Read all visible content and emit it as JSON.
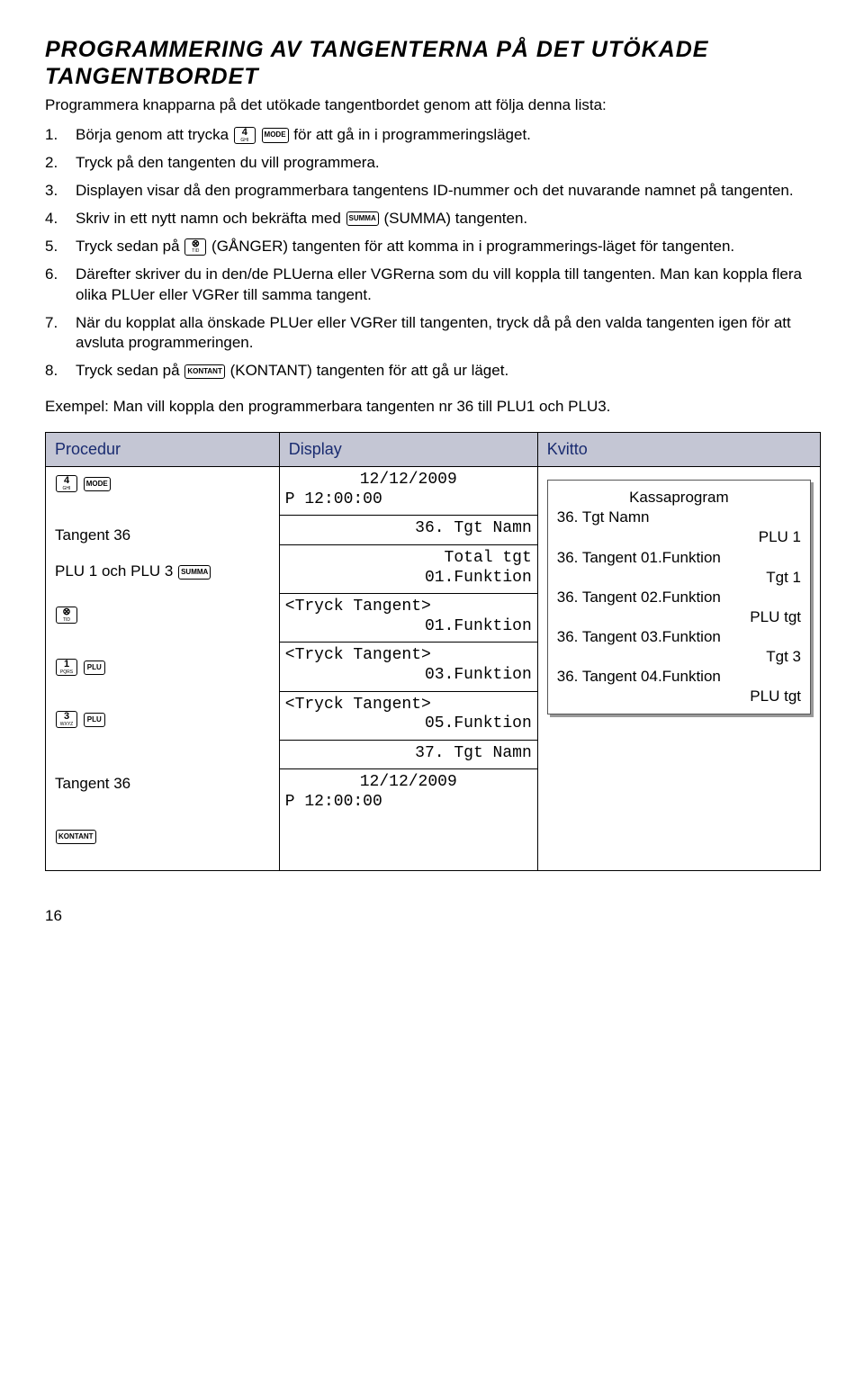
{
  "title": "PROGRAMMERING AV TANGENTERNA PÅ DET UTÖKADE TANGENTBORDET",
  "intro": "Programmera knapparna på det utökade tangentbordet genom att följa denna lista:",
  "steps": [
    {
      "n": "1.",
      "t_before": "Börja genom att trycka ",
      "t_after": " för att gå in i programmeringsläget."
    },
    {
      "n": "2.",
      "t": "Tryck på den tangenten du vill programmera."
    },
    {
      "n": "3.",
      "t": "Displayen visar då den programmerbara tangentens ID-nummer och det nuvarande namnet på tangenten."
    },
    {
      "n": "4.",
      "t_before": "Skriv in ett nytt namn och bekräfta med ",
      "t_after": " (SUMMA) tangenten."
    },
    {
      "n": "5.",
      "t_before": "Tryck sedan på ",
      "t_after": " (GÅNGER) tangenten för att komma in i programmerings-läget för tangenten."
    },
    {
      "n": "6.",
      "t": "Därefter skriver du in den/de PLUerna eller VGRerna som du vill koppla till tangenten. Man kan koppla flera olika PLUer eller VGRer till samma tangent."
    },
    {
      "n": "7.",
      "t": "När du kopplat alla önskade PLUer eller VGRer till tangenten, tryck då på den valda tangenten igen för att avsluta programmeringen."
    },
    {
      "n": "8.",
      "t_before": "Tryck sedan på ",
      "t_after": " (KONTANT) tangenten för att gå ur läget."
    }
  ],
  "example": "Exempel: Man vill koppla den programmerbara tangenten nr 36 till PLU1 och PLU3.",
  "headers": {
    "proc": "Procedur",
    "disp": "Display",
    "kvit": "Kvitto"
  },
  "proc": {
    "tangent36": "Tangent 36",
    "plu13": "PLU 1 och PLU 3 ",
    "tangent36b": "Tangent 36"
  },
  "keys": {
    "k4_big": "4",
    "k4_sm": "GHI",
    "mode": "MODE",
    "summa": "SUMMA",
    "tid_icon": "⊗",
    "tid_sm": "TID",
    "k1_big": "1",
    "k1_sm": "PQRS",
    "plu": "PLU",
    "k3_big": "3",
    "k3_sm": "WXYZ",
    "kontant": "KONTANT"
  },
  "disp": {
    "d1a": "12/12/2009",
    "d1b": "P    12:00:00",
    "d2": "36.   Tgt Namn",
    "d3a": "Total tgt",
    "d3b": "01.Funktion",
    "d4a": "<Tryck Tangent>",
    "d4b": "01.Funktion",
    "d5a": "<Tryck Tangent>",
    "d5b": "03.Funktion",
    "d6a": "<Tryck Tangent>",
    "d6b": "05.Funktion",
    "d7": "37.   Tgt Namn",
    "d8a": "12/12/2009",
    "d8b": "P    12:00:00"
  },
  "receipt": {
    "l1": "Kassaprogram",
    "l2": "36. Tgt Namn",
    "l3": "PLU 1",
    "l4": "36. Tangent 01.Funktion",
    "l5": "Tgt 1",
    "l6": "36. Tangent 02.Funktion",
    "l7": "PLU tgt",
    "l8": "36. Tangent 03.Funktion",
    "l9": "Tgt 3",
    "l10": "36. Tangent 04.Funktion",
    "l11": "PLU tgt"
  },
  "pagenum": "16"
}
